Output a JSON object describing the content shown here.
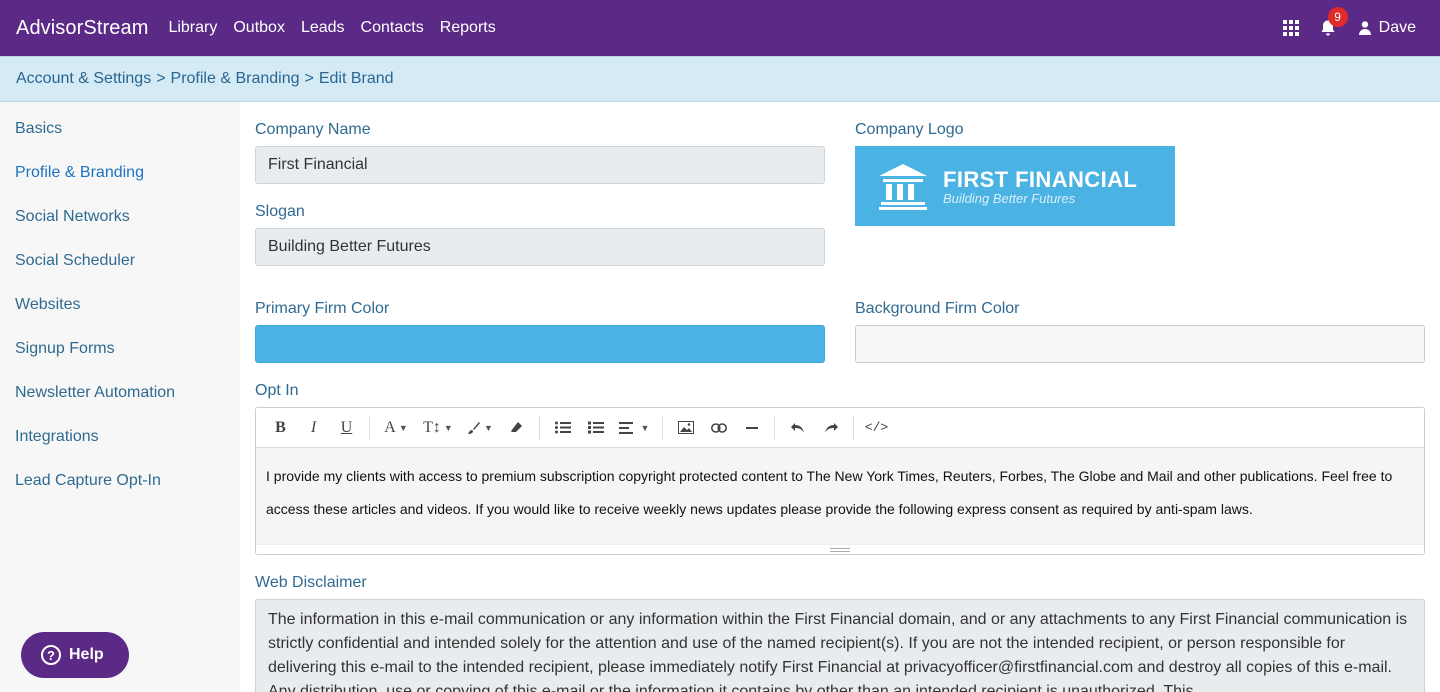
{
  "header": {
    "brand": "AdvisorStream",
    "nav": [
      "Library",
      "Outbox",
      "Leads",
      "Contacts",
      "Reports"
    ],
    "notifications_count": "9",
    "user_name": "Dave"
  },
  "breadcrumb": [
    "Account & Settings",
    "Profile & Branding",
    "Edit Brand"
  ],
  "sidebar": {
    "items": [
      {
        "label": "Basics"
      },
      {
        "label": "Profile & Branding"
      },
      {
        "label": "Social Networks"
      },
      {
        "label": "Social Scheduler"
      },
      {
        "label": "Websites"
      },
      {
        "label": "Signup Forms"
      },
      {
        "label": "Newsletter Automation"
      },
      {
        "label": "Integrations"
      },
      {
        "label": "Lead Capture Opt-In"
      }
    ],
    "active_index": 1
  },
  "form": {
    "company_name_label": "Company Name",
    "company_name_value": "First Financial",
    "slogan_label": "Slogan",
    "slogan_value": "Building Better Futures",
    "company_logo_label": "Company Logo",
    "logo_name": "FIRST FINANCIAL",
    "logo_tagline": "Building Better Futures",
    "primary_color_label": "Primary Firm Color",
    "primary_color": "#4ab3e4",
    "background_color_label": "Background Firm Color",
    "background_color": "#f7f7f7",
    "opt_in_label": "Opt In",
    "opt_in_text": "I provide my clients with access to premium subscription copyright protected content to The New York Times, Reuters, Forbes, The Globe and Mail and other publications. Feel free to access these articles and videos. If you would like to receive weekly news updates please provide the following express consent as required by anti-spam laws.",
    "web_disclaimer_label": "Web Disclaimer",
    "web_disclaimer_text": "The information in this e-mail communication or any information within the First Financial domain, and or any attachments to any First Financial communication is strictly confidential and intended solely for the attention and use of the named recipient(s). If you are not the intended recipient, or person responsible for delivering this e-mail to the intended recipient, please immediately notify First Financial at privacyofficer@firstfinancial.com and destroy all copies of this e-mail. Any distribution, use or copying of this e-mail or the information it contains by other than an intended recipient is unauthorized. This"
  },
  "editor_toolbar": {
    "icons": [
      "bold-icon",
      "italic-icon",
      "underline-icon",
      "font-color-icon",
      "font-size-icon",
      "paint-brush-icon",
      "eraser-icon",
      "unordered-list-icon",
      "ordered-list-icon",
      "align-icon",
      "image-icon",
      "link-icon",
      "horizontal-rule-icon",
      "undo-icon",
      "redo-icon",
      "code-view-icon"
    ]
  },
  "help": {
    "label": "Help"
  }
}
